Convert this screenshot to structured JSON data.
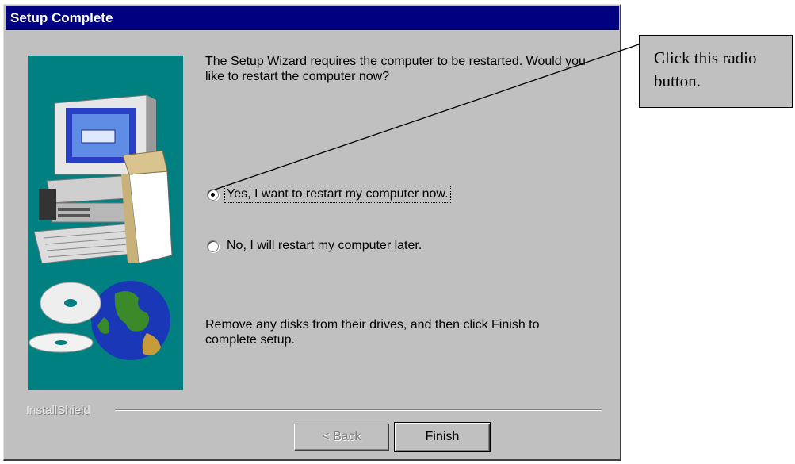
{
  "dialog": {
    "title": "Setup Complete",
    "message_top": "The Setup Wizard requires the computer to be restarted.  Would you like to restart the computer now?",
    "options": [
      {
        "label": "Yes, I want to restart my computer now.",
        "selected": true
      },
      {
        "label": "No, I will restart my computer later.",
        "selected": false
      }
    ],
    "message_bottom": "Remove any disks from their drives, and then click Finish to complete setup.",
    "brand": "InstallShield",
    "buttons": {
      "back": "< Back",
      "finish": "Finish"
    }
  },
  "callout": {
    "text": "Click this radio button."
  },
  "colors": {
    "titlebar": "#000080",
    "dialog": "#c0c0c0",
    "banner": "#008080"
  }
}
